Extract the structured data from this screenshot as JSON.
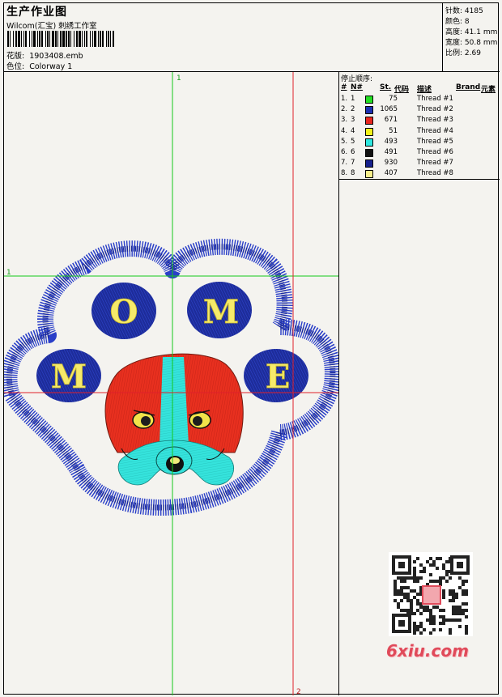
{
  "header": {
    "title": "生产作业图",
    "company": "Wilcom(汇宝) 刺绣工作室",
    "design_file_label": "花版:",
    "design_file": "1903408.emb",
    "colorway_label": "色位:",
    "colorway": "Colorway 1"
  },
  "stats": [
    {
      "label": "针数:",
      "value": "4185"
    },
    {
      "label": "颜色:",
      "value": "8"
    },
    {
      "label": "高度:",
      "value": "41.1 mm"
    },
    {
      "label": "宽度:",
      "value": "50.8 mm"
    },
    {
      "label": "比例:",
      "value": "2.69"
    }
  ],
  "threads": {
    "title": "停止顺序:",
    "headers": [
      "#",
      "N#",
      "St.",
      "代码",
      "描述",
      "Brand",
      "元素"
    ],
    "rows": [
      {
        "n": "1.",
        "nn": "1",
        "color": "#22dd22",
        "st": "75",
        "desc": "Thread #1"
      },
      {
        "n": "2.",
        "nn": "2",
        "color": "#1a2fb0",
        "st": "1065",
        "desc": "Thread #2"
      },
      {
        "n": "3.",
        "nn": "3",
        "color": "#e8251d",
        "st": "671",
        "desc": "Thread #3"
      },
      {
        "n": "4.",
        "nn": "4",
        "color": "#f2f21a",
        "st": "51",
        "desc": "Thread #4"
      },
      {
        "n": "5.",
        "nn": "5",
        "color": "#2ee8e0",
        "st": "493",
        "desc": "Thread #5"
      },
      {
        "n": "6.",
        "nn": "6",
        "color": "#111111",
        "st": "491",
        "desc": "Thread #6"
      },
      {
        "n": "7.",
        "nn": "7",
        "color": "#16208c",
        "st": "930",
        "desc": "Thread #7"
      },
      {
        "n": "8.",
        "nn": "8",
        "color": "#f7ee8c",
        "st": "407",
        "desc": "Thread #8"
      }
    ]
  },
  "design": {
    "marker_1": "1",
    "marker_1b": "1",
    "marker_2": "2",
    "letters": [
      "O",
      "M",
      "M",
      "E"
    ]
  },
  "watermark": {
    "site": "6xiu.com"
  }
}
